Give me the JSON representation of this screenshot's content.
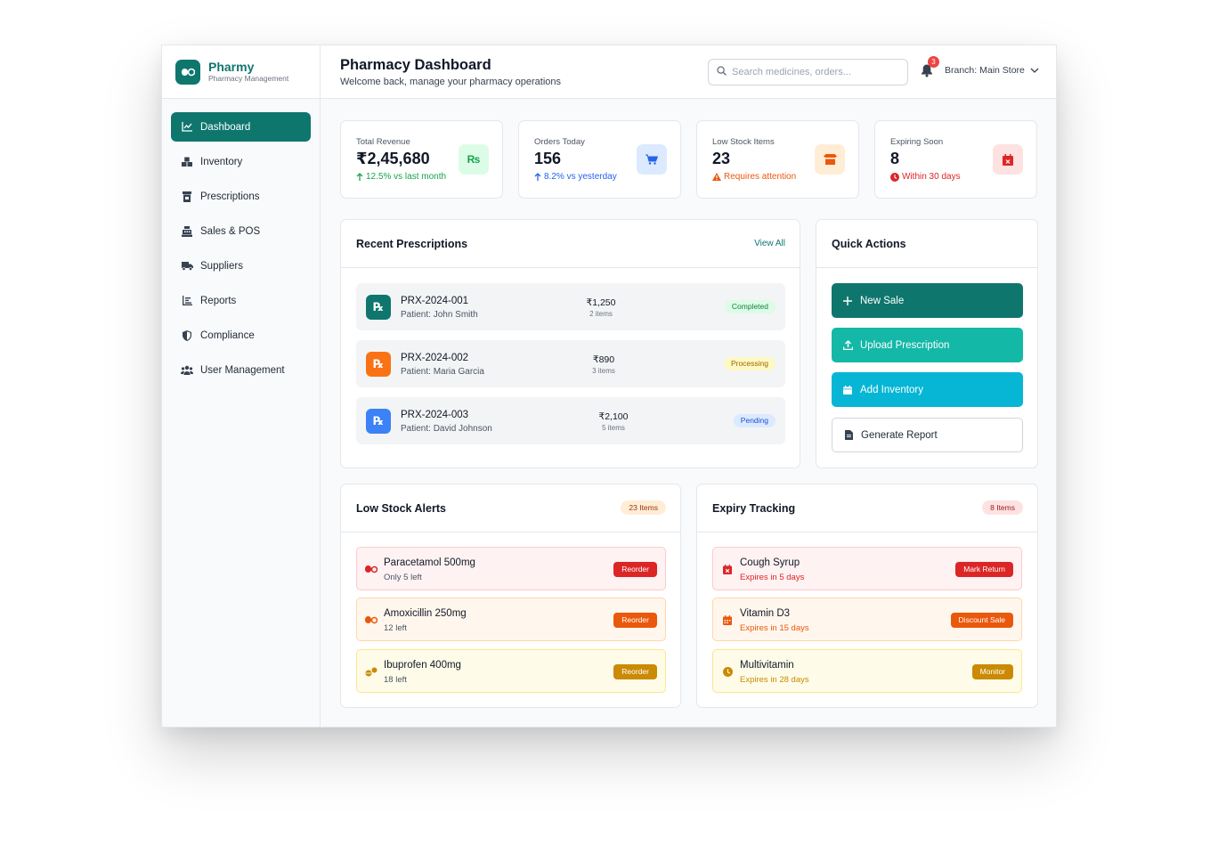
{
  "brand": {
    "name": "Pharmy",
    "subtitle": "Pharmacy Management"
  },
  "nav": [
    {
      "label": "Dashboard",
      "icon": "chart-line-icon",
      "active": true
    },
    {
      "label": "Inventory",
      "icon": "boxes-icon"
    },
    {
      "label": "Prescriptions",
      "icon": "prescription-bottle-icon"
    },
    {
      "label": "Sales & POS",
      "icon": "cash-register-icon"
    },
    {
      "label": "Suppliers",
      "icon": "truck-icon"
    },
    {
      "label": "Reports",
      "icon": "bar-chart-icon"
    },
    {
      "label": "Compliance",
      "icon": "shield-icon"
    },
    {
      "label": "User Management",
      "icon": "users-icon"
    }
  ],
  "header": {
    "title": "Pharmacy Dashboard",
    "subtitle": "Welcome back, manage your pharmacy operations",
    "search_placeholder": "Search medicines, orders...",
    "notification_count": "3",
    "branch": "Branch: Main Store"
  },
  "stats": [
    {
      "label": "Total Revenue",
      "value": "₹2,45,680",
      "note": "12.5% vs last month",
      "note_color": "#16a34a",
      "icon": "rupee-icon",
      "icon_bg": "#dcfce7",
      "icon_color": "#16a34a"
    },
    {
      "label": "Orders Today",
      "value": "156",
      "note": "8.2% vs yesterday",
      "note_color": "#2563eb",
      "icon": "cart-icon",
      "icon_bg": "#dbeafe",
      "icon_color": "#2563eb"
    },
    {
      "label": "Low Stock Items",
      "value": "23",
      "note": "Requires attention",
      "note_color": "#ea580c",
      "icon": "box-open-icon",
      "icon_bg": "#ffedd5",
      "icon_color": "#ea580c"
    },
    {
      "label": "Expiring Soon",
      "value": "8",
      "note": "Within 30 days",
      "note_color": "#dc2626",
      "icon": "calendar-x-icon",
      "icon_bg": "#fee2e2",
      "icon_color": "#dc2626"
    }
  ],
  "prescriptions": {
    "title": "Recent Prescriptions",
    "view_all": "View All",
    "rows": [
      {
        "id": "PRX-2024-001",
        "patient": "Patient: John Smith",
        "amount": "₹1,250",
        "items": "2 items",
        "status": "Completed",
        "icon_bg": "#0f766e",
        "status_bg": "#dcfce7",
        "status_color": "#15803d"
      },
      {
        "id": "PRX-2024-002",
        "patient": "Patient: Maria Garcia",
        "amount": "₹890",
        "items": "3 items",
        "status": "Processing",
        "icon_bg": "#f97316",
        "status_bg": "#fef9c3",
        "status_color": "#a16207"
      },
      {
        "id": "PRX-2024-003",
        "patient": "Patient: David Johnson",
        "amount": "₹2,100",
        "items": "5 items",
        "status": "Pending",
        "icon_bg": "#3b82f6",
        "status_bg": "#dbeafe",
        "status_color": "#1d4ed8"
      }
    ]
  },
  "quick_actions": {
    "title": "Quick Actions",
    "buttons": [
      {
        "label": "New Sale",
        "icon": "plus-icon"
      },
      {
        "label": "Upload Prescription",
        "icon": "upload-icon"
      },
      {
        "label": "Add Inventory",
        "icon": "calendar-plus-icon"
      },
      {
        "label": "Generate Report",
        "icon": "file-icon"
      }
    ]
  },
  "low_stock": {
    "title": "Low Stock Alerts",
    "badge": "23 Items",
    "rows": [
      {
        "name": "Paracetamol 500mg",
        "sub": "Only 5 left",
        "action": "Reorder",
        "icon": "pills-icon"
      },
      {
        "name": "Amoxicillin 250mg",
        "sub": "12 left",
        "action": "Reorder",
        "icon": "pills-icon"
      },
      {
        "name": "Ibuprofen 400mg",
        "sub": "18 left",
        "action": "Reorder",
        "icon": "tablets-icon"
      }
    ]
  },
  "expiry": {
    "title": "Expiry Tracking",
    "badge": "8 Items",
    "rows": [
      {
        "name": "Cough Syrup",
        "sub": "Expires in 5 days",
        "action": "Mark Return",
        "icon": "calendar-x-icon"
      },
      {
        "name": "Vitamin D3",
        "sub": "Expires in 15 days",
        "action": "Discount Sale",
        "icon": "calendar-icon"
      },
      {
        "name": "Multivitamin",
        "sub": "Expires in 28 days",
        "action": "Monitor",
        "icon": "clock-icon"
      }
    ]
  }
}
